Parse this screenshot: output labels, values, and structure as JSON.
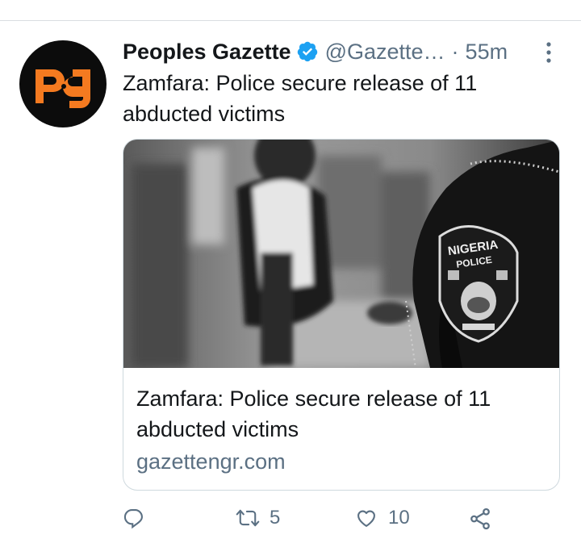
{
  "tweet": {
    "author_name": "Peoples Gazette",
    "handle": "@Gazette…",
    "separator": "·",
    "time": "55m",
    "text": "Zamfara: Police secure release of 11 abducted victims",
    "avatar_logo_text": "pg"
  },
  "card": {
    "title": "Zamfara: Police secure release of 11 abducted victims",
    "domain": "gazettengr.com",
    "badge_text_top": "NIGERIA",
    "badge_text_bottom": "POLICE"
  },
  "actions": {
    "reply_count": "",
    "retweet_count": "5",
    "like_count": "10"
  },
  "colors": {
    "brand_orange": "#f47a20",
    "verified_blue": "#1da1f2",
    "muted_text": "#5b7083",
    "border": "#cfd9de"
  },
  "icons": {
    "verified": "verified-badge-icon",
    "more": "more-vertical-icon",
    "reply": "reply-icon",
    "retweet": "retweet-icon",
    "like": "heart-icon",
    "share": "share-icon"
  }
}
